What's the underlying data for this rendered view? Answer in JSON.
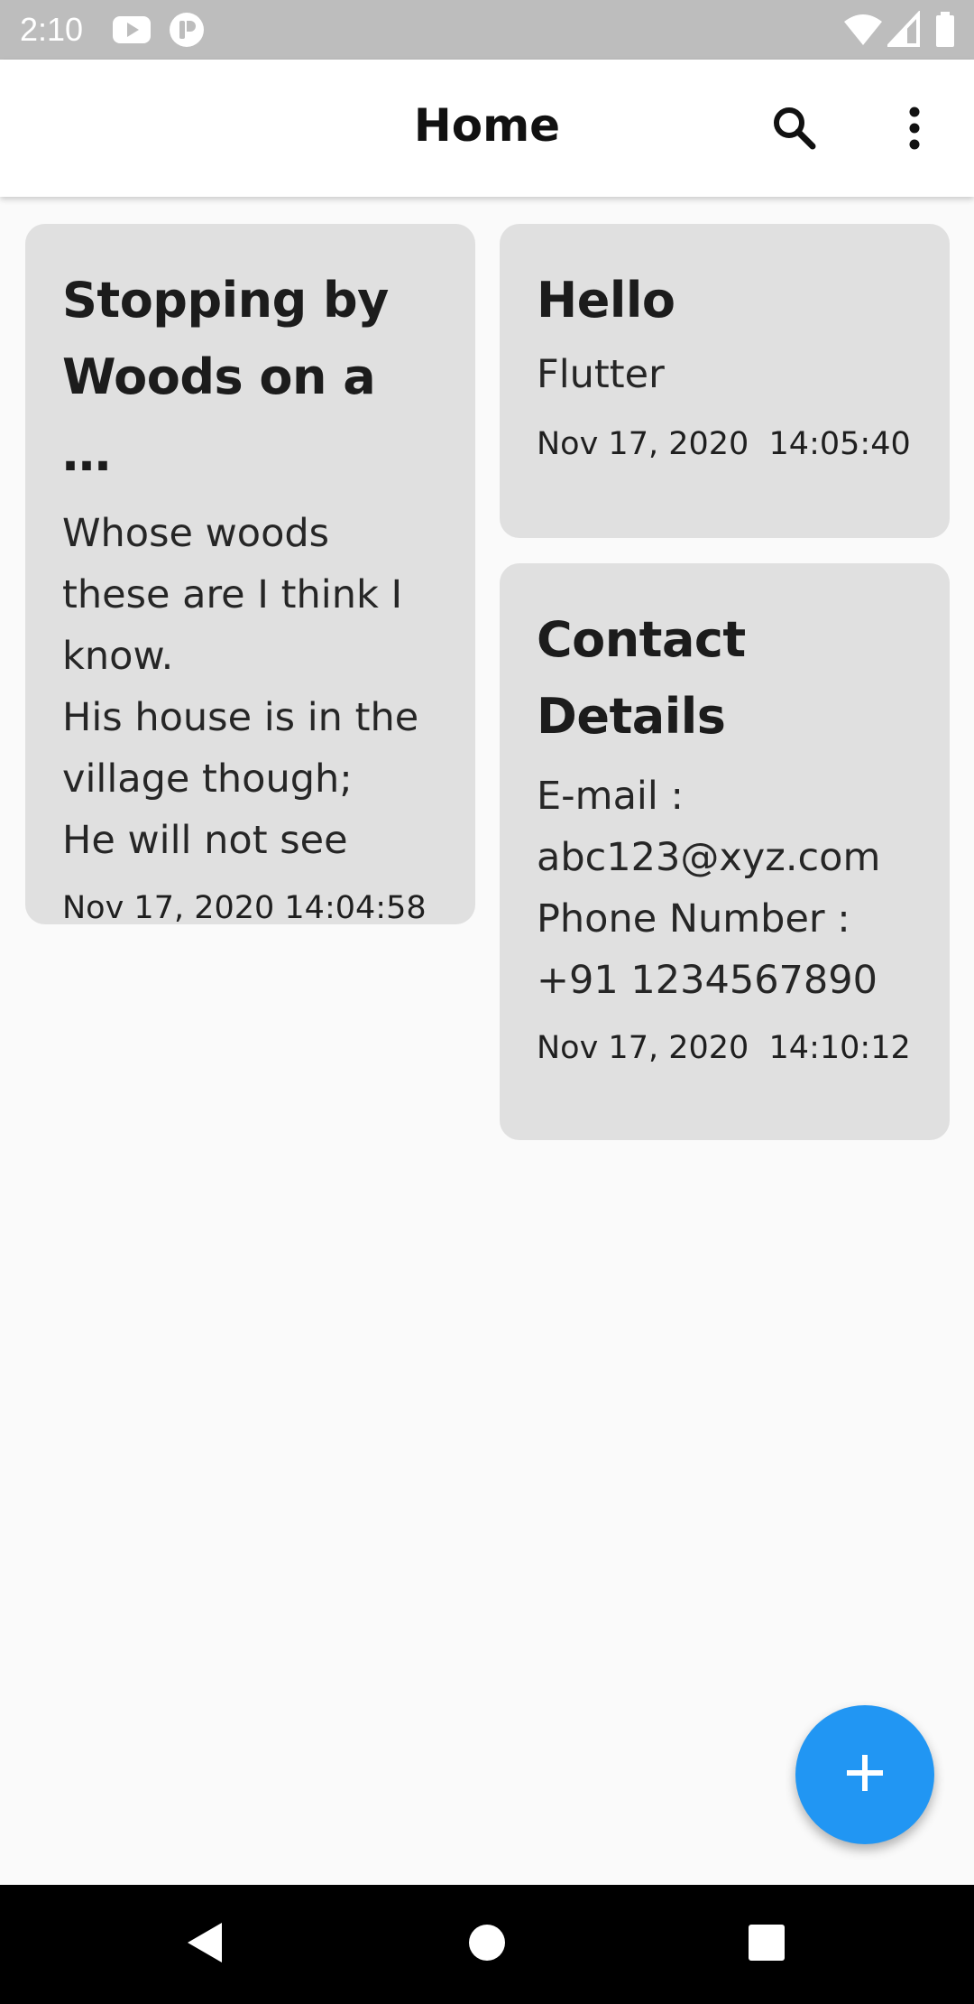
{
  "status_bar": {
    "time": "2:10",
    "icons": [
      "youtube-icon",
      "app-notification-icon",
      "wifi-icon",
      "cellular-signal-icon",
      "battery-icon"
    ],
    "background": "#bdbdbd"
  },
  "app_bar": {
    "title": "Home",
    "actions": [
      "search-icon",
      "more-vert-icon"
    ]
  },
  "notes": [
    {
      "title": "Stopping by Woods on a …",
      "body": "Whose woods these are I think I know.\nHis house is in the village though;\nHe will not see",
      "date": "Nov 17, 2020 14:04:58"
    },
    {
      "title": "Hello",
      "body": "Flutter",
      "date": "Nov 17, 2020  14:05:40"
    },
    {
      "title": "Contact Details",
      "body": "E-mail : abc123@xyz.com\nPhone Number : +91 1234567890",
      "date": "Nov 17, 2020  14:10:12"
    }
  ],
  "fab": {
    "icon": "add-icon",
    "color": "#2196f3"
  },
  "nav_bar": {
    "buttons": [
      "back-icon",
      "home-icon",
      "recents-icon"
    ]
  },
  "colors": {
    "card_background": "#e0e0e0",
    "page_background": "#fafafa",
    "accent": "#2196f3"
  }
}
